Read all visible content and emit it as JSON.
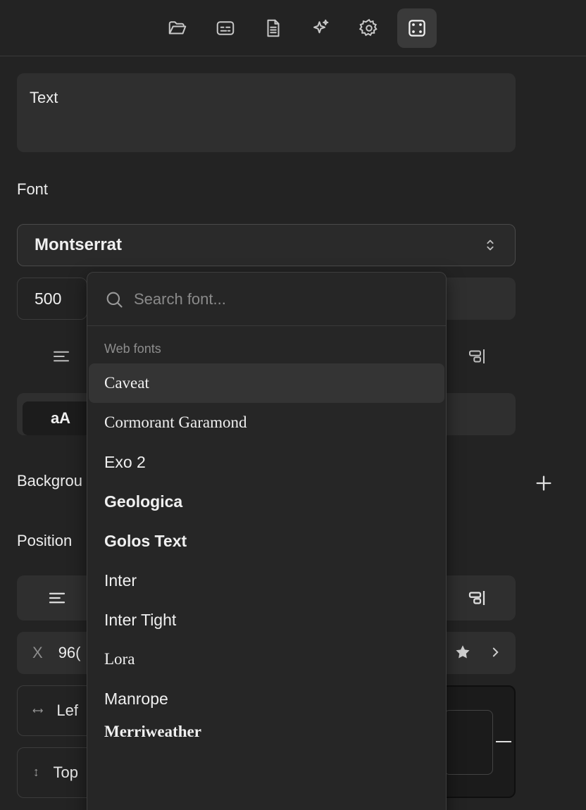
{
  "toolbar": {
    "buttons": [
      {
        "icon": "folder-icon",
        "active": false
      },
      {
        "icon": "subtitles-icon",
        "active": false
      },
      {
        "icon": "document-icon",
        "active": false
      },
      {
        "icon": "sparkles-icon",
        "active": false
      },
      {
        "icon": "gear-icon",
        "active": false
      },
      {
        "icon": "frame-icon",
        "active": true
      }
    ]
  },
  "text_box": {
    "value": "Text"
  },
  "font_section": {
    "label": "Font",
    "selected_font": "Montserrat",
    "weight": "500",
    "case_button": "aA"
  },
  "background_label": "Backgrou",
  "position_label": "Position",
  "position": {
    "x_label": "X",
    "x_value": "96(",
    "left_label": "Lef",
    "top_label": "Top"
  },
  "dropdown": {
    "search_placeholder": "Search font...",
    "group_label": "Web fonts",
    "fonts": [
      "Caveat",
      "Cormorant Garamond",
      "Exo 2",
      "Geologica",
      "Golos Text",
      "Inter",
      "Inter Tight",
      "Lora",
      "Manrope",
      "Merriweather"
    ]
  }
}
